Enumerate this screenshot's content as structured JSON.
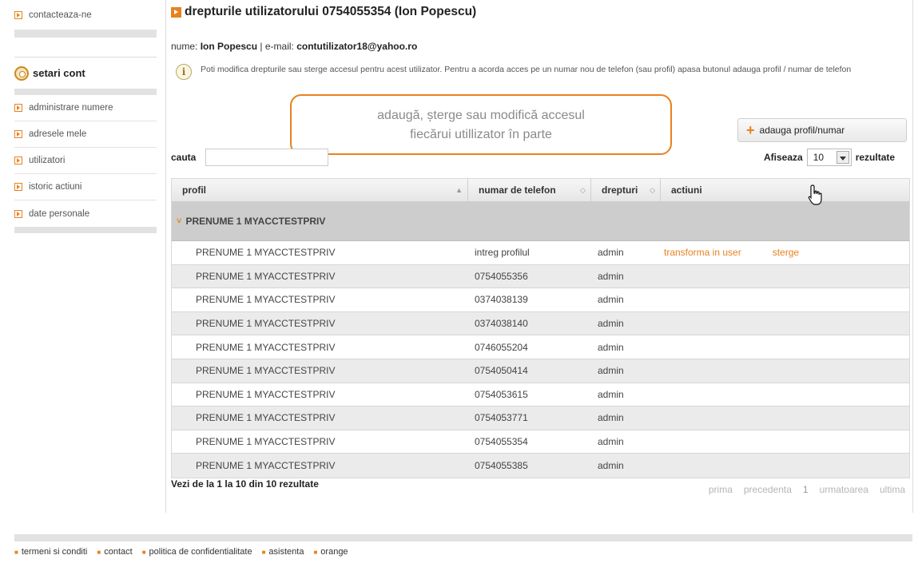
{
  "sidebar": {
    "top_link": "contacteaza-ne",
    "section_title": "setari cont",
    "items": [
      {
        "label": "administrare numere"
      },
      {
        "label": "adresele mele"
      },
      {
        "label": "utilizatori"
      },
      {
        "label": "istoric actiuni"
      },
      {
        "label": "date personale"
      }
    ]
  },
  "header": {
    "title": "drepturile utilizatorului 0754055354 (Ion Popescu)",
    "name_label": "nume:",
    "name_value": "Ion Popescu",
    "separator": "|",
    "email_label": "e-mail:",
    "email_value": "contutilizator18@yahoo.ro",
    "info_text": "Poti modifica drepturile sau sterge accesul pentru acest utilizator. Pentru a acorda acces pe un numar nou de telefon (sau profil) apasa butonul adauga profil / numar de telefon"
  },
  "callout": {
    "line1": "adaugă, șterge sau modifică accesul",
    "line2": "fiecărui utillizator în parte"
  },
  "controls": {
    "add_button": "adauga profil/numar",
    "search_label": "cauta",
    "search_value": "",
    "show_label": "Afiseaza",
    "show_value": "10",
    "results_label": "rezultate"
  },
  "table": {
    "columns": [
      "profil",
      "numar de telefon",
      "drepturi",
      "actiuni"
    ],
    "group": "PRENUME 1 MYACCTESTPRIV",
    "rows": [
      {
        "profil": "PRENUME 1 MYACCTESTPRIV",
        "numar": "intreg profilul",
        "drepturi": "admin",
        "action1": "transforma in user",
        "action2": "sterge"
      },
      {
        "profil": "PRENUME 1 MYACCTESTPRIV",
        "numar": "0754055356",
        "drepturi": "admin"
      },
      {
        "profil": "PRENUME 1 MYACCTESTPRIV",
        "numar": "0374038139",
        "drepturi": "admin"
      },
      {
        "profil": "PRENUME 1 MYACCTESTPRIV",
        "numar": "0374038140",
        "drepturi": "admin"
      },
      {
        "profil": "PRENUME 1 MYACCTESTPRIV",
        "numar": "0746055204",
        "drepturi": "admin"
      },
      {
        "profil": "PRENUME 1 MYACCTESTPRIV",
        "numar": "0754050414",
        "drepturi": "admin"
      },
      {
        "profil": "PRENUME 1 MYACCTESTPRIV",
        "numar": "0754053615",
        "drepturi": "admin"
      },
      {
        "profil": "PRENUME 1 MYACCTESTPRIV",
        "numar": "0754053771",
        "drepturi": "admin"
      },
      {
        "profil": "PRENUME 1 MYACCTESTPRIV",
        "numar": "0754055354",
        "drepturi": "admin"
      },
      {
        "profil": "PRENUME 1 MYACCTESTPRIV",
        "numar": "0754055385",
        "drepturi": "admin"
      }
    ]
  },
  "pagination": {
    "info_prefix": "Vezi de la",
    "from": "1",
    "mid1": "la",
    "to": "10",
    "mid2": "din",
    "total": "10",
    "suffix": "rezultate",
    "first": "prima",
    "prev": "precedenta",
    "page": "1",
    "next": "urmatoarea",
    "last": "ultima"
  },
  "footer": {
    "links": [
      "termeni si conditi",
      "contact",
      "politica de confidentialitate",
      "asistenta",
      "orange"
    ]
  },
  "colors": {
    "accent": "#e8821e",
    "group_row": "#cdcdcd",
    "alt_row": "#ebebeb"
  }
}
